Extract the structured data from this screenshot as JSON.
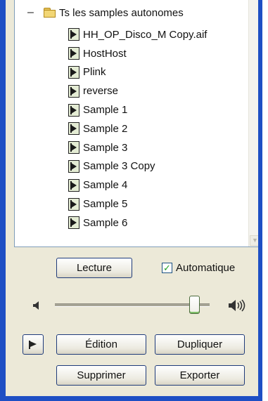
{
  "tree": {
    "root_label": "Ts les samples autonomes",
    "collapse_glyph": "–",
    "items": [
      {
        "label": "HH_OP_Disco_M Copy.aif"
      },
      {
        "label": "HostHost"
      },
      {
        "label": "Plink"
      },
      {
        "label": "reverse"
      },
      {
        "label": "Sample 1"
      },
      {
        "label": "Sample 2"
      },
      {
        "label": "Sample 3"
      },
      {
        "label": "Sample 3 Copy"
      },
      {
        "label": "Sample 4"
      },
      {
        "label": "Sample 5"
      },
      {
        "label": "Sample 6"
      }
    ]
  },
  "playback": {
    "play_label": "Lecture",
    "auto_label": "Automatique",
    "auto_checked": true,
    "volume_level": 0.93
  },
  "actions": {
    "edit_label": "Édition",
    "duplicate_label": "Dupliquer",
    "delete_label": "Supprimer",
    "export_label": "Exporter"
  },
  "colors": {
    "frame": "#1e4fc4",
    "panel": "#ece9d8",
    "checkmark": "#21a121"
  },
  "icons": {
    "tree_folder": "folder-icon",
    "sample": "sample-flag-icon",
    "volume_low": "speaker-low-icon",
    "volume_high": "speaker-high-icon",
    "flag_button": "flag-icon"
  }
}
